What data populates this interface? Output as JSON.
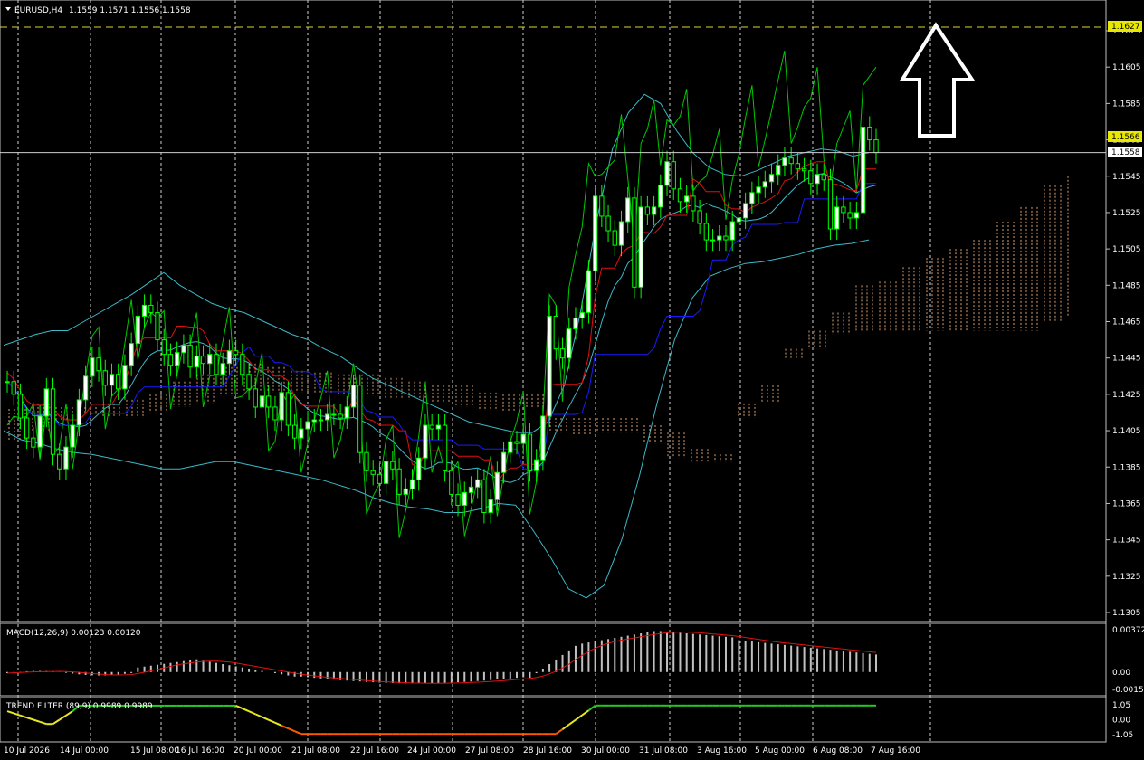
{
  "header": {
    "symbol_label": "EURUSD,H4",
    "ohlc": "1.1559 1.1571 1.1556 1.1558",
    "menu_icon": "triangle-down-icon"
  },
  "main_axis": {
    "ticks": [
      "1.1625",
      "1.1605",
      "1.1585",
      "1.1565",
      "1.1545",
      "1.1525",
      "1.1505",
      "1.1485",
      "1.1465",
      "1.1445",
      "1.1425",
      "1.1405",
      "1.1385",
      "1.1365",
      "1.1345",
      "1.1325",
      "1.1305"
    ],
    "tag_top": "1.1627",
    "tag_mid": "1.1566",
    "tag_bid": "1.1558"
  },
  "macd_panel": {
    "label": "MACD(12,26,9) 0.00123 0.00120",
    "ticks": [
      "0.00372",
      "0.00",
      "-0.00153"
    ]
  },
  "trend_panel": {
    "label": "TREND FILTER (89,9) 0.9989 0.9989",
    "ticks": [
      "1.05",
      "0.00",
      "-1.05"
    ]
  },
  "time_axis": [
    "10 Jul 2026",
    "14 Jul 00:00",
    "15 Jul 08:00",
    "16 Jul 16:00",
    "20 Jul 00:00",
    "21 Jul 08:00",
    "22 Jul 16:00",
    "24 Jul 00:00",
    "27 Jul 08:00",
    "28 Jul 16:00",
    "30 Jul 00:00",
    "31 Jul 08:00",
    "3 Aug 16:00",
    "5 Aug 00:00",
    "6 Aug 08:00",
    "7 Aug 16:00"
  ],
  "annotation": {
    "icon": "up-arrow-icon"
  },
  "colors": {
    "background": "#000000",
    "bull_candle": "#ffffff",
    "bear_candle": "#000000",
    "candle_wick": "#00ff00",
    "bollinger": "#3cb8c8",
    "envelope": "#00c800",
    "tenkan": "#e01010",
    "kijun": "#1a1aff",
    "kumo": "#d8a070",
    "level_line": "#d8d830",
    "macd_hist": "#c0c0c0",
    "macd_signal": "#e01010",
    "trend_green": "#22cc22",
    "trend_yellow": "#e8e820",
    "trend_orange": "#ff5a00"
  },
  "chart_data": {
    "type": "candlestick",
    "symbol": "EURUSD",
    "timeframe": "H4",
    "ylim": [
      1.1295,
      1.164
    ],
    "levels": [
      1.1627,
      1.1566
    ],
    "bid": 1.1558,
    "closes": [
      1.1432,
      1.1425,
      1.1412,
      1.1401,
      1.1396,
      1.1413,
      1.1428,
      1.1392,
      1.1384,
      1.1396,
      1.1408,
      1.1422,
      1.1435,
      1.1445,
      1.1438,
      1.143,
      1.1436,
      1.1428,
      1.1441,
      1.1453,
      1.1468,
      1.1474,
      1.147,
      1.1455,
      1.1447,
      1.1441,
      1.1448,
      1.1452,
      1.144,
      1.1446,
      1.1442,
      1.1447,
      1.1436,
      1.1442,
      1.1449,
      1.1447,
      1.1436,
      1.1428,
      1.1418,
      1.1424,
      1.1418,
      1.1411,
      1.1426,
      1.1408,
      1.1401,
      1.1406,
      1.141,
      1.1411,
      1.1411,
      1.1414,
      1.1414,
      1.1412,
      1.1418,
      1.143,
      1.1393,
      1.1383,
      1.1381,
      1.1376,
      1.1388,
      1.1384,
      1.137,
      1.1373,
      1.1378,
      1.139,
      1.1408,
      1.1406,
      1.1408,
      1.1383,
      1.137,
      1.1364,
      1.1371,
      1.1374,
      1.1378,
      1.136,
      1.1367,
      1.1382,
      1.1393,
      1.1399,
      1.1398,
      1.1403,
      1.1383,
      1.1389,
      1.1413,
      1.1468,
      1.145,
      1.1445,
      1.1461,
      1.1467,
      1.147,
      1.1493,
      1.1534,
      1.1523,
      1.1515,
      1.1507,
      1.152,
      1.1533,
      1.1484,
      1.1528,
      1.1524,
      1.1528,
      1.154,
      1.1553,
      1.1538,
      1.1531,
      1.1534,
      1.1526,
      1.1519,
      1.151,
      1.151,
      1.1512,
      1.151,
      1.152,
      1.1522,
      1.153,
      1.1536,
      1.1539,
      1.1542,
      1.1546,
      1.1551,
      1.1555,
      1.1552,
      1.1549,
      1.1548,
      1.1541,
      1.1546,
      1.1543,
      1.1516,
      1.1528,
      1.1525,
      1.1522,
      1.1525,
      1.1572,
      1.1565,
      1.1558
    ],
    "bollinger_upper": [
      1.1452,
      1.1455,
      1.1458,
      1.146,
      1.146,
      1.1465,
      1.147,
      1.1475,
      1.148,
      1.1486,
      1.1492,
      1.1485,
      1.148,
      1.1475,
      1.1472,
      1.147,
      1.1466,
      1.1462,
      1.1458,
      1.1455,
      1.145,
      1.1446,
      1.144,
      1.1434,
      1.143,
      1.1426,
      1.1422,
      1.1418,
      1.1414,
      1.141,
      1.1408,
      1.1406,
      1.1404,
      1.1404,
      1.141,
      1.143,
      1.147,
      1.152,
      1.156,
      1.158,
      1.159,
      1.1585,
      1.157,
      1.1558,
      1.155,
      1.1546,
      1.1545,
      1.1548,
      1.1552,
      1.1556,
      1.1558,
      1.156,
      1.1559,
      1.1556,
      1.1558
    ],
    "bollinger_lower": [
      1.1405,
      1.14,
      1.1398,
      1.1395,
      1.1393,
      1.1392,
      1.139,
      1.1388,
      1.1386,
      1.1384,
      1.1384,
      1.1386,
      1.1388,
      1.1388,
      1.1386,
      1.1384,
      1.1382,
      1.138,
      1.1378,
      1.1375,
      1.1372,
      1.1368,
      1.1365,
      1.1363,
      1.1362,
      1.136,
      1.136,
      1.1362,
      1.1365,
      1.1364,
      1.135,
      1.1335,
      1.1318,
      1.1313,
      1.132,
      1.1345,
      1.138,
      1.142,
      1.1455,
      1.1478,
      1.149,
      1.1494,
      1.1497,
      1.1498,
      1.15,
      1.1502,
      1.1505,
      1.1507,
      1.1508,
      1.151
    ]
  }
}
